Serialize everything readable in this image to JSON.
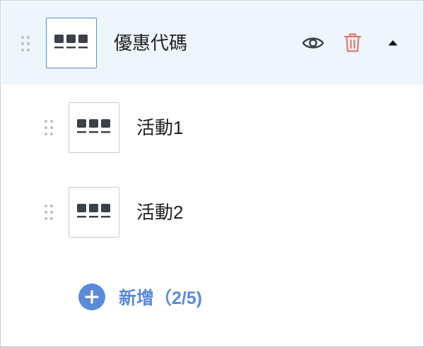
{
  "menu": {
    "parent": {
      "label": "優惠代碼",
      "thumb_icon": "button-group-icon",
      "actions": {
        "visibility_icon": "eye-icon",
        "delete_icon": "trash-icon",
        "collapse_icon": "caret-up-icon"
      }
    },
    "children": [
      {
        "label": "活動1",
        "thumb_icon": "button-group-icon"
      },
      {
        "label": "活動2",
        "thumb_icon": "button-group-icon"
      }
    ],
    "add": {
      "label": "新增（2/5)",
      "icon": "plus-circle-icon"
    }
  },
  "colors": {
    "accent": "#5b8ad8",
    "selected_row_bg": "#eef5fd",
    "delete_icon": "#e07a6b",
    "icon_dark": "#3b4049"
  }
}
